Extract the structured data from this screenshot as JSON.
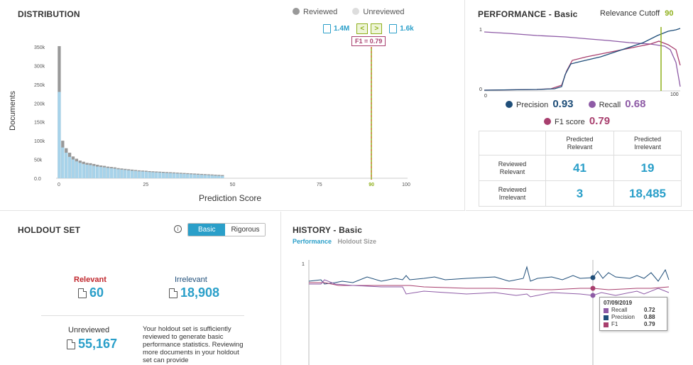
{
  "distribution": {
    "title": "DISTRIBUTION",
    "legend_reviewed": "Reviewed",
    "legend_unreviewed": "Unreviewed",
    "count_left": "1.4M",
    "count_right": "1.6k",
    "f1_badge": "F1 = 0.79",
    "ylabel": "Documents",
    "xlabel": "Prediction Score",
    "yticks": [
      "350k",
      "300k",
      "250k",
      "200k",
      "150k",
      "100k",
      "50k",
      "0.0"
    ],
    "xticks": [
      "0",
      "25",
      "50",
      "75",
      "90",
      "100"
    ],
    "cutoff_color": "#8fb01c",
    "reviewed_color": "#999999",
    "unreviewed_color": "#a7d3ea"
  },
  "chart_data": {
    "type": "bar",
    "xlabel": "Prediction Score",
    "ylabel": "Documents",
    "ylim": [
      0,
      375000
    ],
    "x": [
      0,
      1,
      2,
      3,
      4,
      5,
      6,
      7,
      8,
      9,
      10,
      11,
      12,
      13,
      14,
      15,
      16,
      17,
      18,
      19,
      20,
      21,
      22,
      23,
      24,
      25,
      26,
      27,
      28,
      29,
      30,
      31,
      32,
      33,
      34,
      35,
      36,
      37,
      38,
      39,
      40,
      41,
      42,
      43,
      44,
      45,
      46,
      47,
      48,
      49,
      50
    ],
    "series": [
      {
        "name": "Reviewed",
        "values": [
          352000,
          100000,
          80000,
          68000,
          58000,
          52000,
          47000,
          44000,
          41000,
          40000,
          38000,
          36000,
          34000,
          33000,
          31000,
          30000,
          29000,
          27000,
          26000,
          25000,
          24000,
          23000,
          22000,
          21000,
          20500,
          20000,
          19000,
          18500,
          18000,
          17500,
          17000,
          16500,
          16000,
          15500,
          15000,
          14500,
          14000,
          13500,
          13000,
          12500,
          12000,
          11500,
          11000,
          10500,
          10000,
          9500,
          9000,
          8500,
          0,
          0,
          0
        ]
      },
      {
        "name": "Unreviewed",
        "values": [
          230000,
          82000,
          68000,
          57000,
          50000,
          45000,
          41000,
          38000,
          36000,
          35000,
          33000,
          31000,
          30000,
          29000,
          27500,
          26500,
          25500,
          24000,
          23000,
          22000,
          21000,
          20000,
          19500,
          18500,
          18000,
          17500,
          16500,
          16000,
          15500,
          15000,
          14500,
          14000,
          13500,
          13000,
          12500,
          12000,
          11500,
          11000,
          10500,
          10000,
          9500,
          9000,
          8500,
          8000,
          7500,
          7000,
          6500,
          6000,
          0,
          0,
          0
        ]
      }
    ],
    "cutoff": 90
  },
  "performance": {
    "title": "PERFORMANCE - Basic",
    "cutoff_label": "Relevance Cutoff",
    "cutoff_value": "90",
    "y_top": "1",
    "y_bottom": "0",
    "x_left": "0",
    "x_right": "100",
    "precision_label": "Precision",
    "precision_value": "0.93",
    "recall_label": "Recall",
    "recall_value": "0.68",
    "f1_label": "F1 score",
    "f1_value": "0.79",
    "precision_color": "#1f4e79",
    "recall_color": "#8e5ba6",
    "f1_color": "#a83f6e"
  },
  "confusion": {
    "col1": "Predicted Relevant",
    "col2": "Predicted Irrelevant",
    "row1": "Reviewed Relevant",
    "row2": "Reviewed Irrelevant",
    "tp": "41",
    "fn": "19",
    "fp": "3",
    "tn": "18,485"
  },
  "holdout": {
    "title": "HOLDOUT SET",
    "toggle_basic": "Basic",
    "toggle_rigorous": "Rigorous",
    "relevant_label": "Relevant",
    "relevant_value": "60",
    "irrelevant_label": "Irrelevant",
    "irrelevant_value": "18,908",
    "unreviewed_label": "Unreviewed",
    "unreviewed_value": "55,167",
    "message": "Your holdout set is sufficiently reviewed to generate basic performance statistics. Reviewing more documents in your holdout set can provide"
  },
  "history": {
    "title": "HISTORY - Basic",
    "tab_performance": "Performance",
    "tab_holdout": "Holdout Size",
    "y_top": "1",
    "tooltip_date": "07/09/2019",
    "tooltip_recall_label": "Recall",
    "tooltip_recall_value": "0.72",
    "tooltip_precision_label": "Precision",
    "tooltip_precision_value": "0.88",
    "tooltip_f1_label": "F1",
    "tooltip_f1_value": "0.79"
  }
}
